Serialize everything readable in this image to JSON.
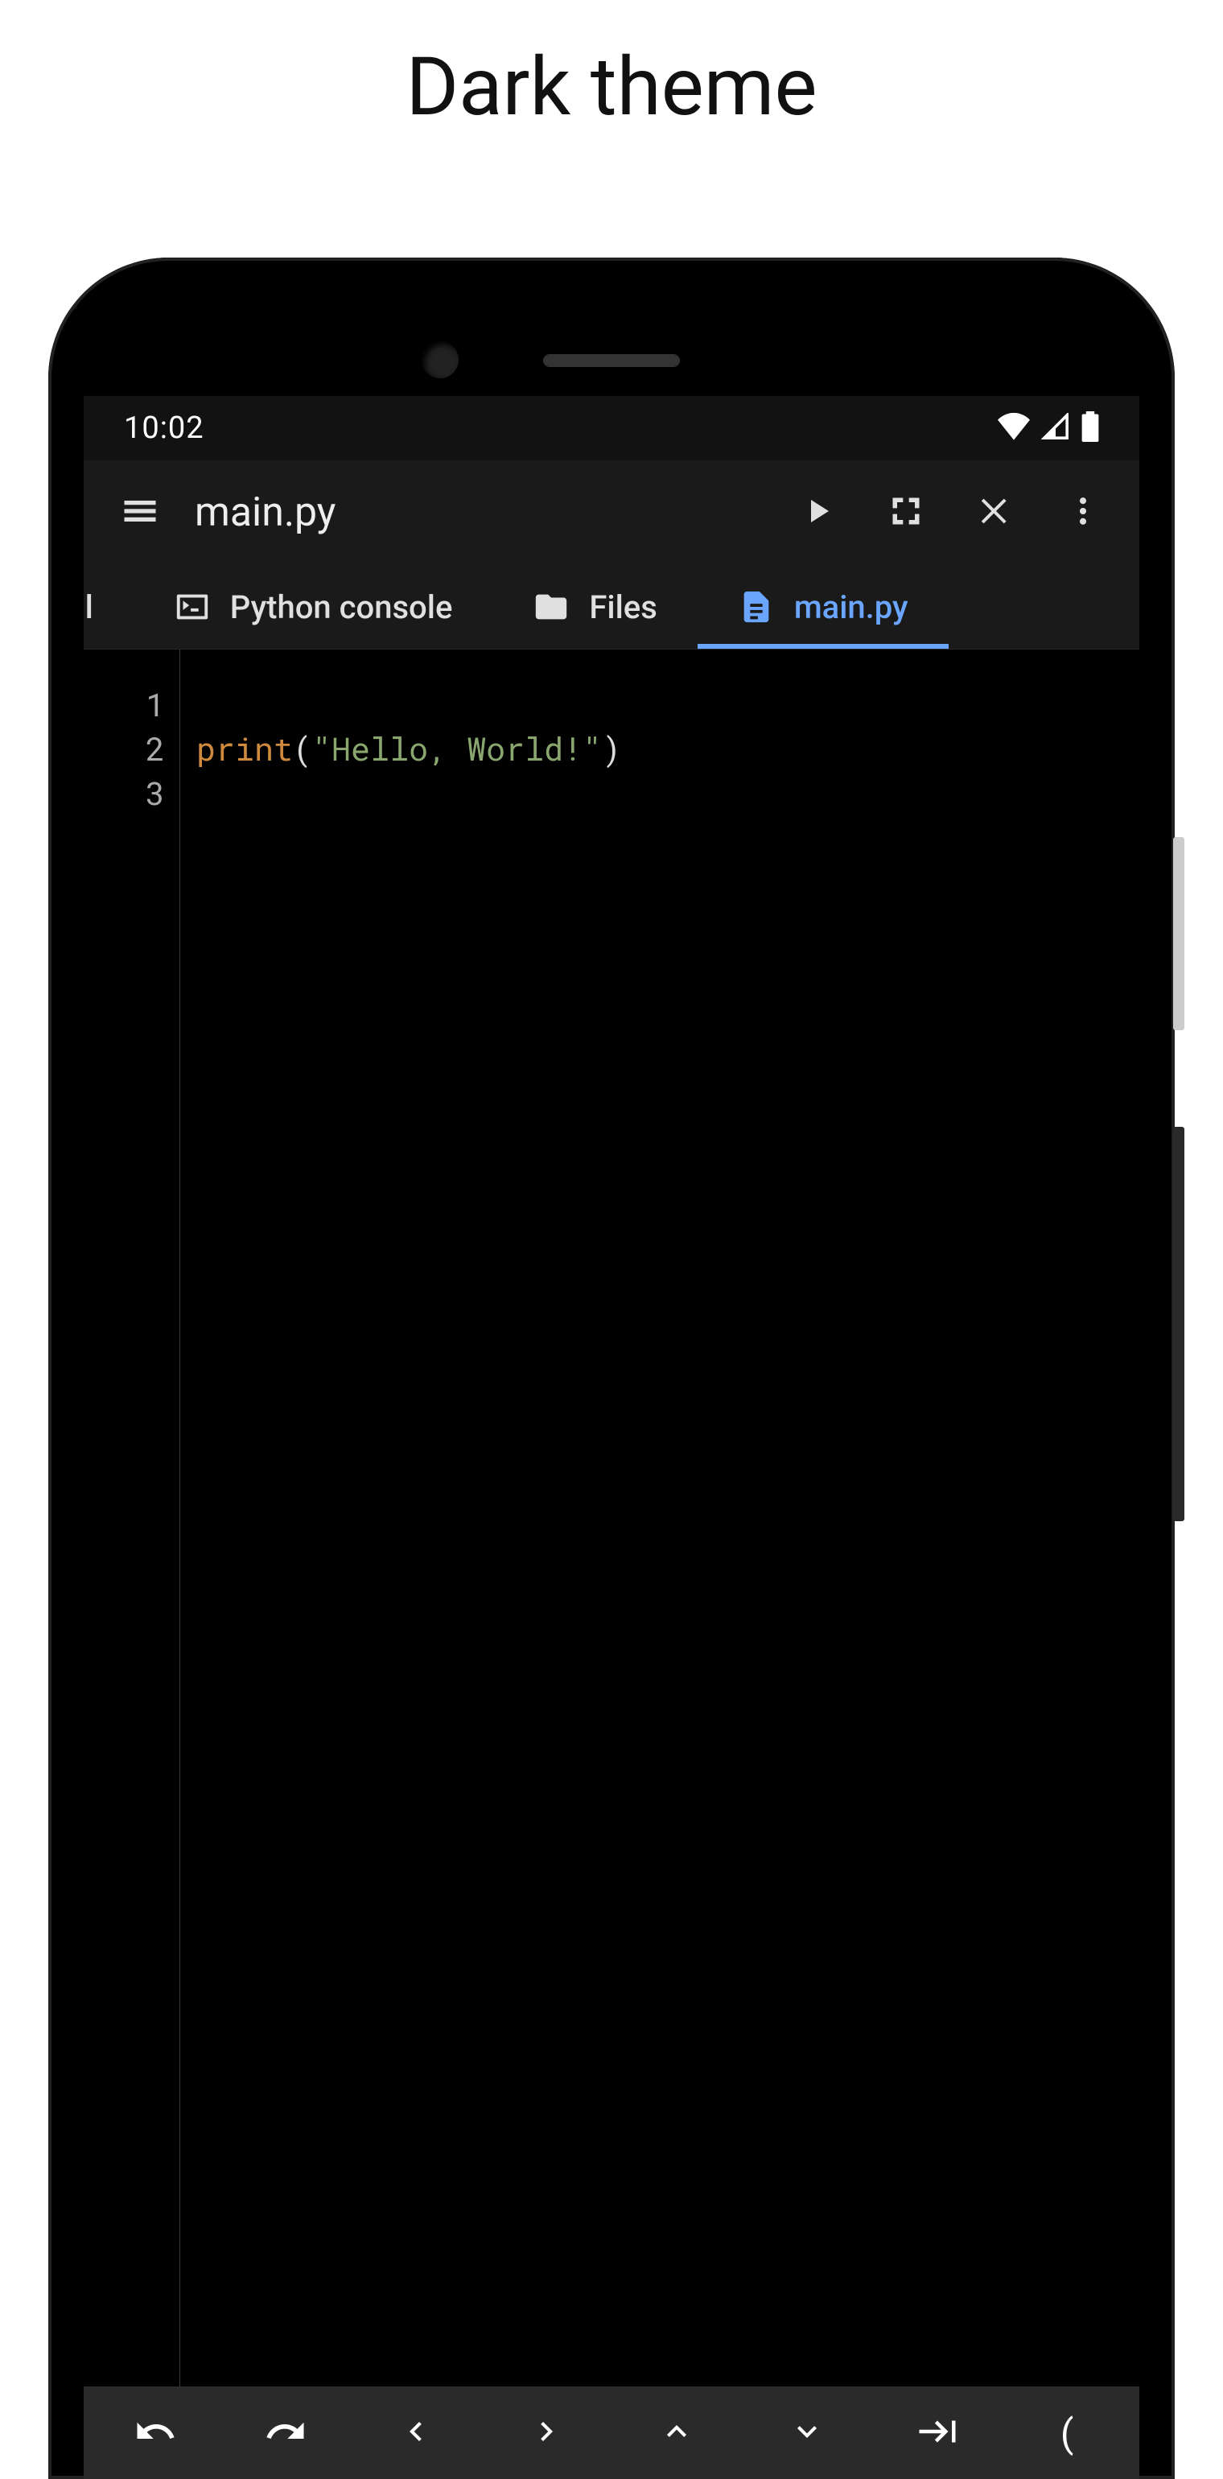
{
  "caption": "Dark theme",
  "status": {
    "time": "10:02"
  },
  "appbar": {
    "title": "main.py"
  },
  "tabs": {
    "partial_label": "al",
    "items": [
      {
        "label": "Python console",
        "icon": "console-icon",
        "active": false
      },
      {
        "label": "Files",
        "icon": "folder-icon",
        "active": false
      },
      {
        "label": "main.py",
        "icon": "file-icon",
        "active": true
      }
    ]
  },
  "editor": {
    "line_numbers": [
      "1",
      "2",
      "3"
    ],
    "line2": {
      "fn": "print",
      "open": "(",
      "str": "\"Hello, World!\"",
      "close": ")"
    }
  },
  "bottombar": {
    "paren": "("
  }
}
